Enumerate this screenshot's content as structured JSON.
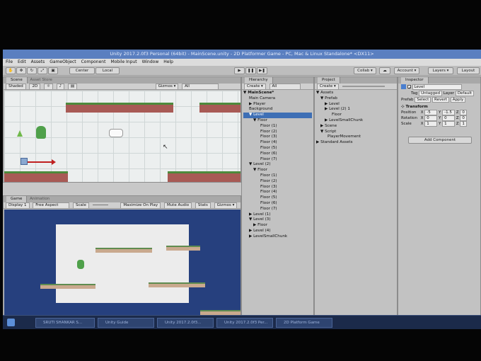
{
  "window": {
    "title": "Unity 2017.2.0f3 Personal (64bit) - MainScene.unity - 2D Platformer Game - PC, Mac & Linux Standalone* <DX11>"
  },
  "menu": [
    "File",
    "Edit",
    "Assets",
    "GameObject",
    "Component",
    "Mobile Input",
    "Window",
    "Help"
  ],
  "toolbar": {
    "center": "Center",
    "local": "Local",
    "collab": "Collab ▾",
    "account": "Account ▾",
    "layers": "Layers ▾",
    "layout": "Layout"
  },
  "scene": {
    "tab": "Scene",
    "tab2": "Asset Store",
    "shading": "Shaded",
    "mode": "2D",
    "gizmos": "Gizmos ▾",
    "search": "All"
  },
  "game": {
    "tab": "Game",
    "tab2": "Animation",
    "display": "Display 1",
    "aspect": "Free Aspect",
    "scale": "Scale",
    "maximize": "Maximize On Play",
    "mute": "Mute Audio",
    "stats": "Stats",
    "gizmos": "Gizmos ▾"
  },
  "hierarchy": {
    "tab": "Hierarchy",
    "create": "Create ▾",
    "search": "All",
    "items": [
      "▼ MainScene*",
      "Main Camera",
      "▶ Player",
      "Background",
      "▼ Level",
      "▼ Floor",
      "Floor (1)",
      "Floor (2)",
      "Floor (3)",
      "Floor (4)",
      "Floor (5)",
      "Floor (6)",
      "Floor (7)",
      "▼ Level (2)",
      "▼ Floor",
      "Floor (1)",
      "Floor (2)",
      "Floor (3)",
      "Floor (4)",
      "Floor (5)",
      "Floor (6)",
      "Floor (7)",
      "▶ Level (1)",
      "▼ Level (3)",
      "▶ Floor",
      "▶ Level (4)",
      "▶ LevelSmallChunk"
    ]
  },
  "project": {
    "tab": "Project",
    "create": "Create ▾",
    "items": [
      "▼ Assets",
      "▼ Prefab",
      "▶ Level",
      "▶ Level (2) 1",
      "Floor",
      "▶ LevelSmallChunk",
      "▶ Scene",
      "▼ Script",
      "PlayerMovement",
      "▶ Standard Assets"
    ]
  },
  "inspector": {
    "tab": "Inspector",
    "name": "Level",
    "tag_label": "Tag",
    "tag": "Untagged",
    "layer_label": "Layer",
    "layer": "Default",
    "prefab_label": "Prefab",
    "select": "Select",
    "revert": "Revert",
    "apply": "Apply",
    "transform": "Transform",
    "rows": [
      {
        "label": "Position",
        "x": "-5",
        "y": "-1.5",
        "z": "0"
      },
      {
        "label": "Rotation",
        "x": "0",
        "y": "0",
        "z": "0"
      },
      {
        "label": "Scale",
        "x": "1",
        "y": "1",
        "z": "1"
      }
    ],
    "add_component": "Add Component"
  },
  "taskbar": [
    "SRUTI SHANKAR S...",
    "Unity Guide",
    "Unity 2017.2.0f3...",
    "Unity 2017.2.0f3 Per...",
    "2D Platform Game"
  ]
}
